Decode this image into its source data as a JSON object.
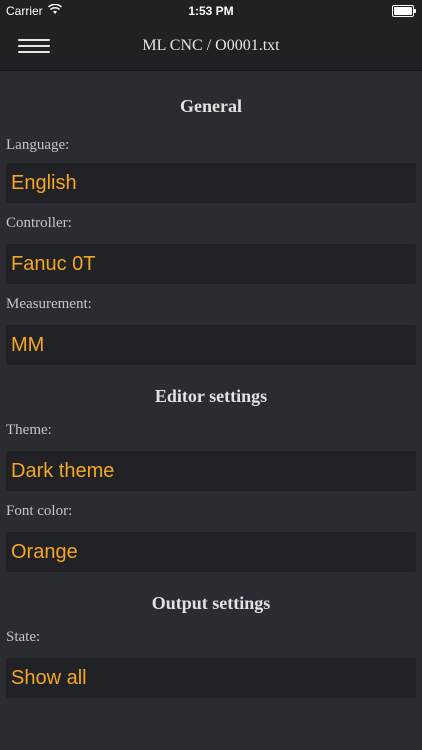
{
  "status_bar": {
    "carrier": "Carrier",
    "time": "1:53 PM",
    "icons": [
      "wifi-icon",
      "battery-icon"
    ]
  },
  "nav": {
    "title": "ML CNC / O0001.txt",
    "menu_icon": "hamburger-menu-icon"
  },
  "sections": {
    "general": {
      "heading": "General",
      "language_label": "Language:",
      "language_value": "English",
      "controller_label": "Controller:",
      "controller_value": "Fanuc 0T",
      "measurement_label": "Measurement:",
      "measurement_value": "MM"
    },
    "editor": {
      "heading": "Editor settings",
      "theme_label": "Theme:",
      "theme_value": "Dark theme",
      "font_color_label": "Font color:",
      "font_color_value": "Orange"
    },
    "output": {
      "heading": "Output settings",
      "state_label": "State:",
      "state_value": "Show all"
    }
  },
  "colors": {
    "background": "#2a2c31",
    "bar": "#1f2125",
    "value_bg": "#202226",
    "accent": "#f5a623",
    "text": "#d6d6d6"
  }
}
